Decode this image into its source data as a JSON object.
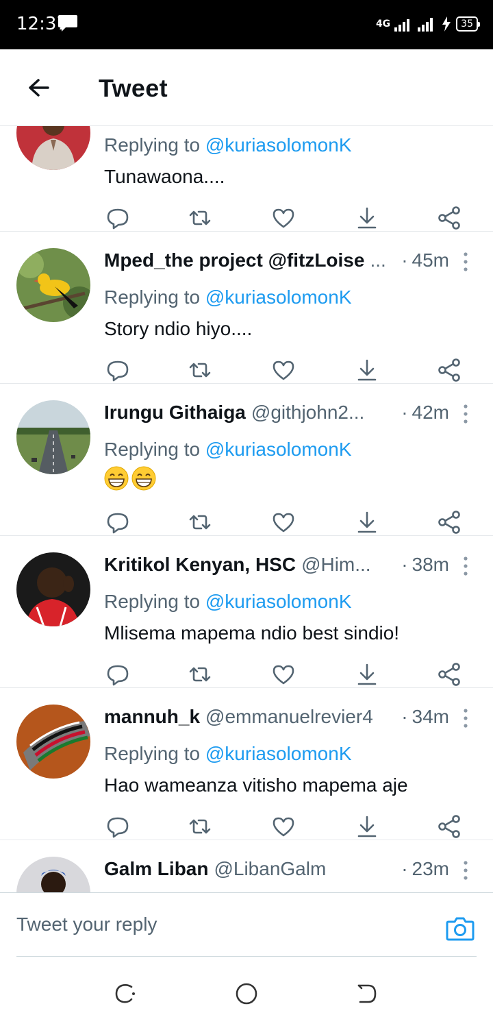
{
  "status_bar": {
    "time": "12:37",
    "network": "4G",
    "battery": "35",
    "icons": [
      "message-icon",
      "signal-icon",
      "charging-icon",
      "battery-icon"
    ]
  },
  "header": {
    "title": "Tweet",
    "back_icon": "arrow-left-icon"
  },
  "colors": {
    "accent": "#1d9bf0",
    "secondary_text": "#536471",
    "primary_text": "#0f1419",
    "divider": "#e6e9ec"
  },
  "replies": [
    {
      "name": "",
      "handle": "",
      "time": "",
      "replying_prefix": "Replying to ",
      "replying_to": "@kuriasolomonK",
      "text": "Tunawaona....",
      "emoji": []
    },
    {
      "name": "Mped_the project @fitzLoise",
      "handle": "...",
      "time": "45m",
      "replying_prefix": "Replying to ",
      "replying_to": "@kuriasolomonK",
      "text": "Story ndio hiyo....",
      "emoji": []
    },
    {
      "name": "Irungu Githaiga",
      "handle": "@githjohn2...",
      "time": "42m",
      "replying_prefix": "Replying to ",
      "replying_to": "@kuriasolomonK",
      "text": "",
      "emoji": [
        "grinning-face",
        "grinning-face"
      ]
    },
    {
      "name": "Kritikol Kenyan, HSC",
      "handle": "@Him...",
      "time": "38m",
      "replying_prefix": "Replying to ",
      "replying_to": "@kuriasolomonK",
      "text": "Mlisema mapema ndio best sindio!",
      "emoji": []
    },
    {
      "name": "mannuh_k",
      "handle": "@emmanuelrevier4",
      "time": "34m",
      "replying_prefix": "Replying to ",
      "replying_to": "@kuriasolomonK",
      "text": "Hao wameanza vitisho mapema aje",
      "emoji": []
    },
    {
      "name": "Galm Liban",
      "handle": "@LibanGalm",
      "time": "23m",
      "replying_prefix": "",
      "replying_to": "",
      "text": "",
      "emoji": []
    }
  ],
  "action_icons": [
    "reply-icon",
    "retweet-icon",
    "like-icon",
    "download-icon",
    "share-icon"
  ],
  "reply_bar": {
    "placeholder": "Tweet your reply",
    "camera_icon": "camera-icon"
  },
  "nav_bar": {
    "icons": [
      "recent-apps-icon",
      "home-icon",
      "back-nav-icon"
    ]
  }
}
